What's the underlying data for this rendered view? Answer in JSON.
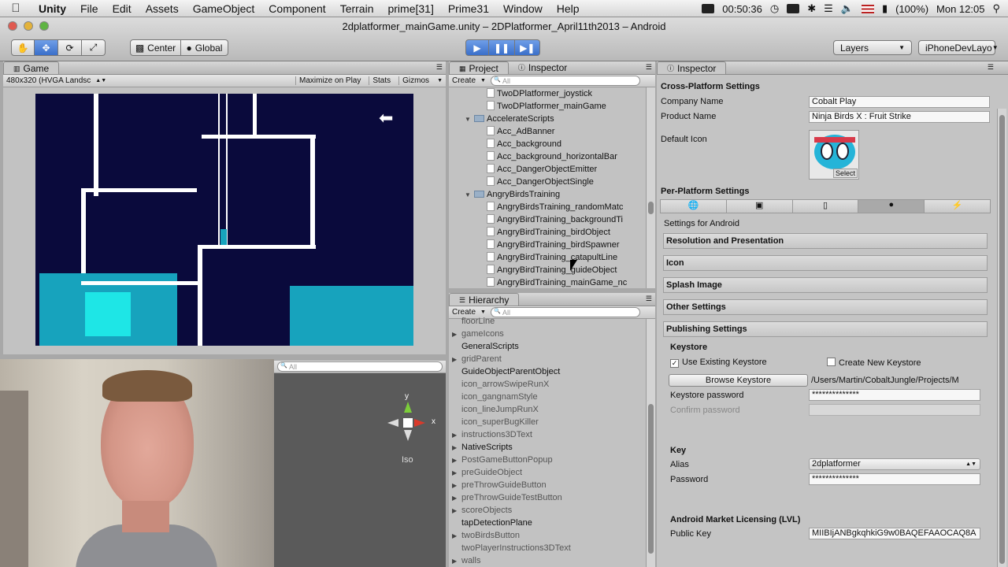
{
  "menubar": {
    "app": "Unity",
    "items": [
      "File",
      "Edit",
      "Assets",
      "GameObject",
      "Component",
      "Terrain",
      "prime[31]",
      "Prime31",
      "Window",
      "Help"
    ],
    "clock": "00:50:36",
    "battery": "(100%)",
    "datetime": "Mon 12:05"
  },
  "window": {
    "title": "2dplatformer_mainGame.unity – 2DPlatformer_April11th2013 – Android"
  },
  "toolbar": {
    "center": "Center",
    "global": "Global",
    "layers": "Layers",
    "layout": "iPhoneDevLayo"
  },
  "game": {
    "tab": "Game",
    "resolution": "480x320 (HVGA Landsc",
    "maximize": "Maximize on Play",
    "stats": "Stats",
    "gizmos": "Gizmos"
  },
  "scene": {
    "search_placeholder": "All",
    "gizmo_y": "y",
    "gizmo_x": "x",
    "iso": "Iso"
  },
  "project": {
    "tab": "Project",
    "tab2": "Inspector",
    "create": "Create",
    "search_placeholder": "All",
    "items": [
      {
        "label": "TwoDPlatformer_joystick",
        "indent": 2,
        "type": "script"
      },
      {
        "label": "TwoDPlatformer_mainGame",
        "indent": 2,
        "type": "script"
      },
      {
        "label": "AccelerateScripts",
        "indent": 1,
        "type": "folder"
      },
      {
        "label": "Acc_AdBanner",
        "indent": 2,
        "type": "script"
      },
      {
        "label": "Acc_background",
        "indent": 2,
        "type": "script"
      },
      {
        "label": "Acc_background_horizontalBar",
        "indent": 2,
        "type": "script"
      },
      {
        "label": "Acc_DangerObjectEmitter",
        "indent": 2,
        "type": "script"
      },
      {
        "label": "Acc_DangerObjectSingle",
        "indent": 2,
        "type": "script"
      },
      {
        "label": "AngryBirdsTraining",
        "indent": 1,
        "type": "folder"
      },
      {
        "label": "AngryBirdsTraining_randomMatc",
        "indent": 2,
        "type": "script"
      },
      {
        "label": "AngryBirdTraining_backgroundTi",
        "indent": 2,
        "type": "script"
      },
      {
        "label": "AngryBirdTraining_birdObject",
        "indent": 2,
        "type": "script"
      },
      {
        "label": "AngryBirdTraining_birdSpawner",
        "indent": 2,
        "type": "script"
      },
      {
        "label": "AngryBirdTraining_catapultLine",
        "indent": 2,
        "type": "script"
      },
      {
        "label": "AngryBirdTraining_guideObject",
        "indent": 2,
        "type": "script"
      },
      {
        "label": "AngryBirdTraining_mainGame_nc",
        "indent": 2,
        "type": "script"
      }
    ]
  },
  "hierarchy": {
    "tab": "Hierarchy",
    "create": "Create",
    "search_placeholder": "All",
    "items": [
      {
        "label": "floorLine",
        "arrow": false,
        "dim": true
      },
      {
        "label": "gameIcons",
        "arrow": true,
        "dim": true
      },
      {
        "label": "GeneralScripts",
        "arrow": false,
        "dim": false
      },
      {
        "label": "gridParent",
        "arrow": true,
        "dim": true
      },
      {
        "label": "GuideObjectParentObject",
        "arrow": false,
        "dim": false
      },
      {
        "label": "icon_arrowSwipeRunX",
        "arrow": false,
        "dim": true
      },
      {
        "label": "icon_gangnamStyle",
        "arrow": false,
        "dim": true
      },
      {
        "label": "icon_lineJumpRunX",
        "arrow": false,
        "dim": true
      },
      {
        "label": "icon_superBugKiller",
        "arrow": false,
        "dim": true
      },
      {
        "label": "instructions3DText",
        "arrow": true,
        "dim": true
      },
      {
        "label": "NativeScripts",
        "arrow": true,
        "dim": false
      },
      {
        "label": "PostGameButtonPopup",
        "arrow": true,
        "dim": true
      },
      {
        "label": "preGuideObject",
        "arrow": true,
        "dim": true
      },
      {
        "label": "preThrowGuideButton",
        "arrow": true,
        "dim": true
      },
      {
        "label": "preThrowGuideTestButton",
        "arrow": true,
        "dim": true
      },
      {
        "label": "scoreObjects",
        "arrow": true,
        "dim": true
      },
      {
        "label": "tapDetectionPlane",
        "arrow": false,
        "dim": false
      },
      {
        "label": "twoBirdsButton",
        "arrow": true,
        "dim": true
      },
      {
        "label": "twoPlayerInstructions3DText",
        "arrow": false,
        "dim": true
      },
      {
        "label": "walls",
        "arrow": true,
        "dim": true
      }
    ]
  },
  "inspector": {
    "tab": "Inspector",
    "cross_platform": "Cross-Platform Settings",
    "company_label": "Company Name",
    "company_value": "Cobalt Play",
    "product_label": "Product Name",
    "product_value": "Ninja Birds X : Fruit Strike",
    "default_icon_label": "Default Icon",
    "select": "Select",
    "per_platform": "Per-Platform Settings",
    "settings_for": "Settings for Android",
    "sections": [
      "Resolution and Presentation",
      "Icon",
      "Splash Image",
      "Other Settings",
      "Publishing Settings"
    ],
    "keystore": "Keystore",
    "use_existing": "Use Existing Keystore",
    "create_new": "Create New Keystore",
    "browse": "Browse Keystore",
    "keystore_path": "/Users/Martin/CobaltJungle/Projects/M",
    "keystore_password_label": "Keystore password",
    "keystore_password": "**************",
    "confirm_password_label": "Confirm password",
    "key": "Key",
    "alias_label": "Alias",
    "alias_value": "2dplatformer",
    "password_label": "Password",
    "password_value": "**************",
    "licensing": "Android Market Licensing (LVL)",
    "public_key_label": "Public Key",
    "public_key_value": "MIIBIjANBgkqhkiG9w0BAQEFAAOCAQ8A"
  },
  "colors": {
    "game_bg": "#0a0a3c",
    "platform": "#17a3bd",
    "highlight": "#1ee6e6"
  }
}
